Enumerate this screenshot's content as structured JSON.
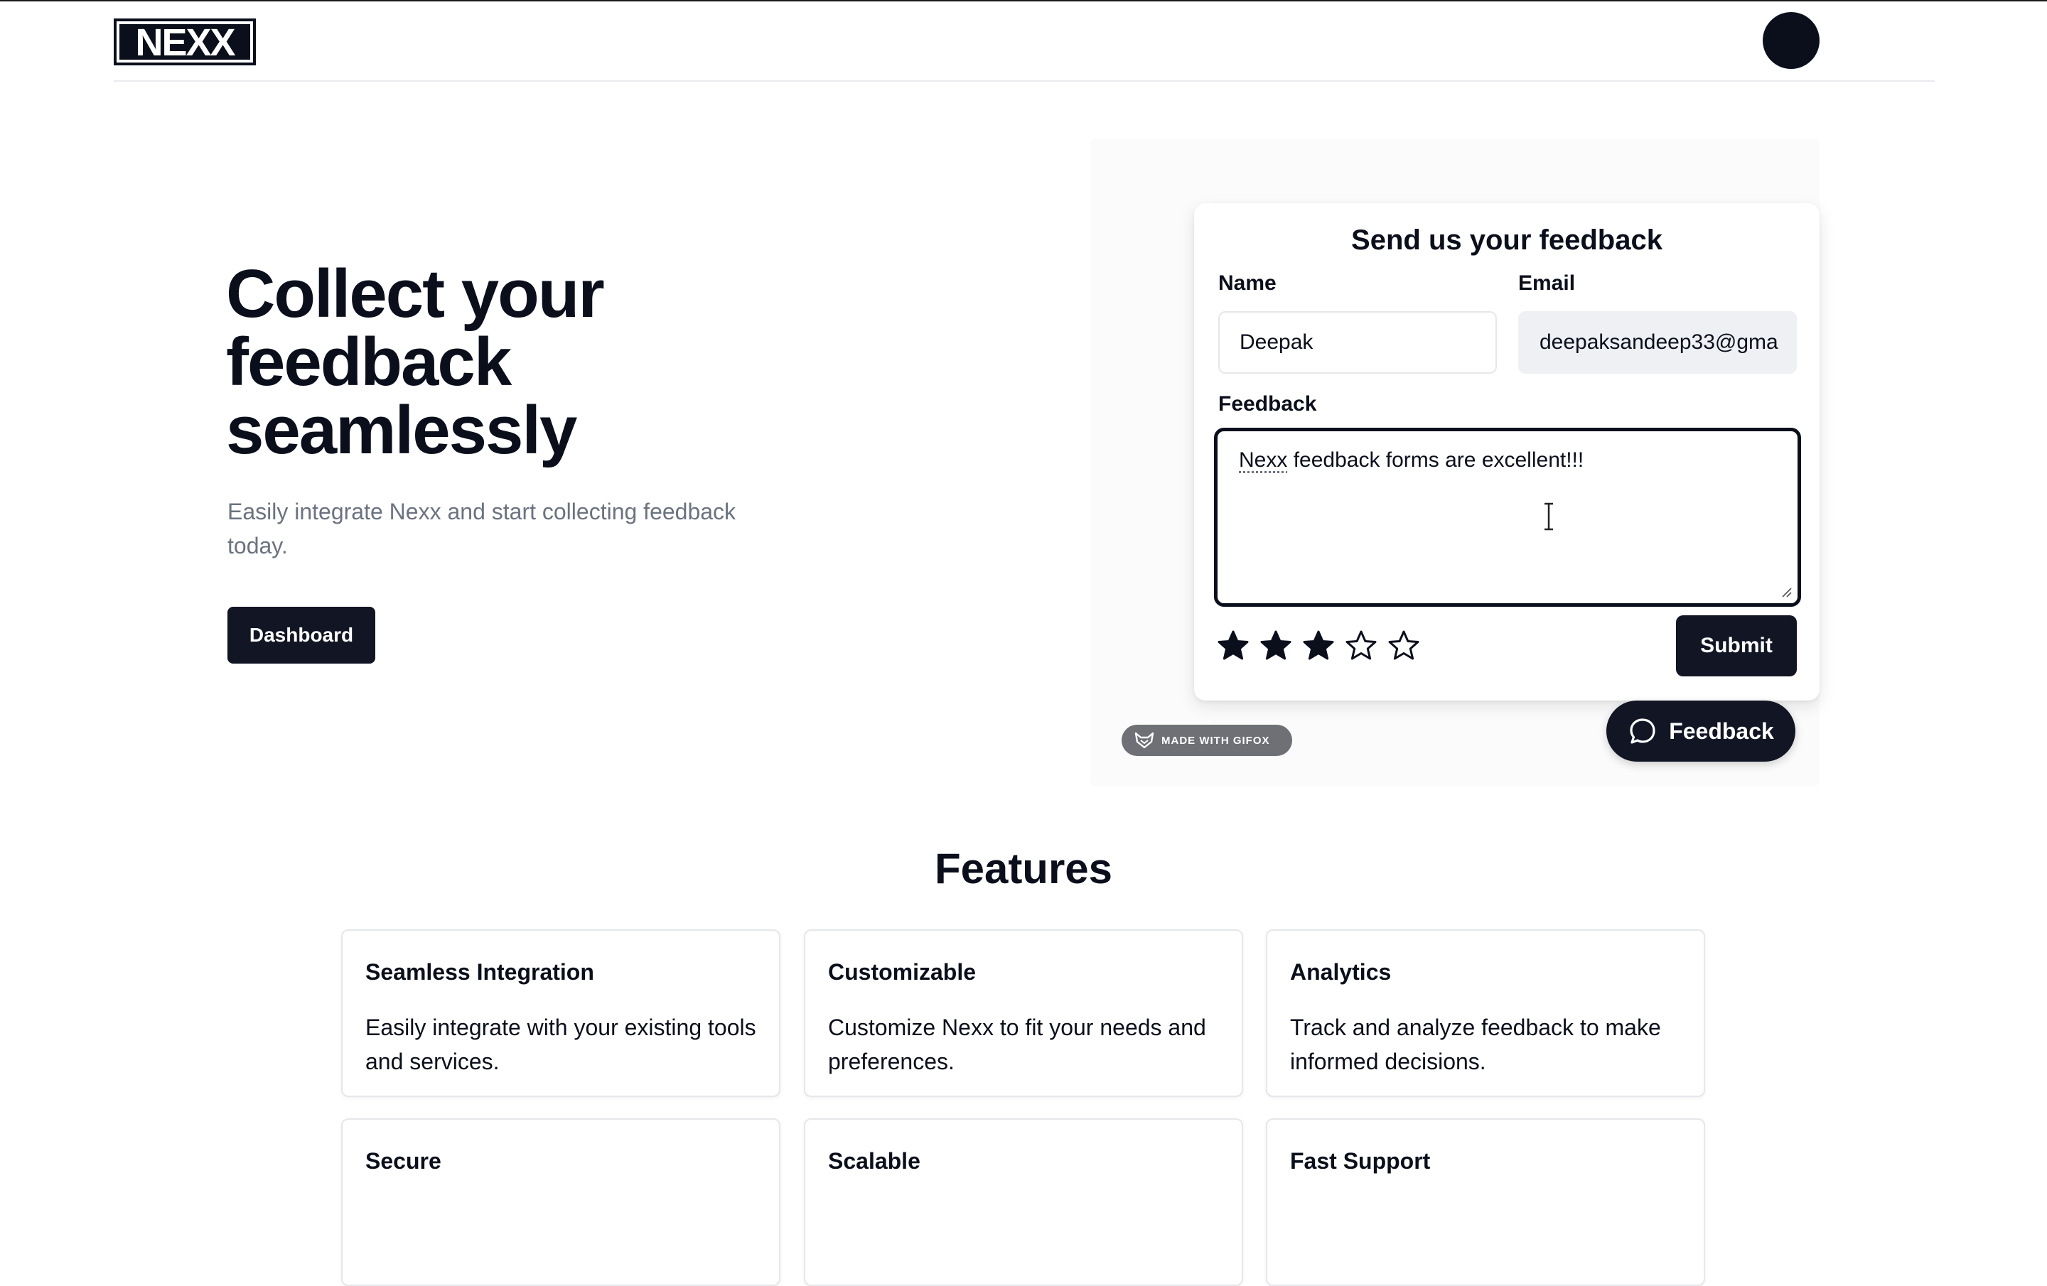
{
  "header": {
    "logo_text": "NEXX"
  },
  "hero": {
    "title": "Collect your feedback seamlessly",
    "subtitle": "Easily integrate Nexx and start collecting feedback today.",
    "dashboard_label": "Dashboard"
  },
  "feedback_form": {
    "title": "Send us your feedback",
    "name_label": "Name",
    "name_value": "Deepak",
    "email_label": "Email",
    "email_value": "deepaksandeep33@gma",
    "feedback_label": "Feedback",
    "feedback_word1": "Nexx",
    "feedback_rest": " feedback forms are excellent!!!",
    "rating": 3,
    "rating_max": 5,
    "submit_label": "Submit"
  },
  "gifox_badge": "MADE WITH GIFOX",
  "feedback_button_label": "Feedback",
  "features": {
    "title": "Features",
    "items": [
      {
        "title": "Seamless Integration",
        "desc": "Easily integrate with your existing tools and services."
      },
      {
        "title": "Customizable",
        "desc": "Customize Nexx to fit your needs and preferences."
      },
      {
        "title": "Analytics",
        "desc": "Track and analyze feedback to make informed decisions."
      },
      {
        "title": "Secure",
        "desc": ""
      },
      {
        "title": "Scalable",
        "desc": ""
      },
      {
        "title": "Fast Support",
        "desc": ""
      }
    ]
  },
  "colors": {
    "primary": "#111524",
    "muted_text": "#6b7280",
    "border": "#e5e7eb"
  },
  "icons": [
    "nexx-logo-icon",
    "avatar",
    "star-icon",
    "chat-bubble-icon",
    "fox-icon",
    "ibeam-cursor-icon"
  ]
}
